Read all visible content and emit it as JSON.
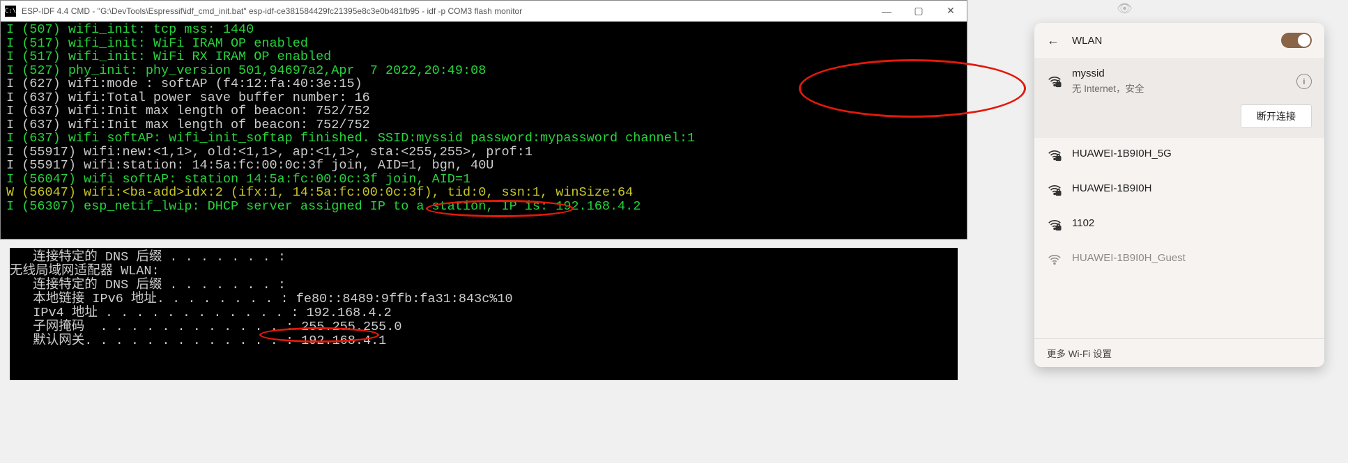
{
  "terminal": {
    "title": "ESP-IDF 4.4 CMD - \"G:\\DevTools\\Espressif\\idf_cmd_init.bat\"  esp-idf-ce381584429fc21395e8c3e0b481fb95 - idf  -p COM3 flash monitor",
    "icon_text": "C:\\",
    "lines": [
      {
        "cls": "green",
        "text": "I (507) wifi_init: tcp mss: 1440"
      },
      {
        "cls": "green",
        "text": "I (517) wifi_init: WiFi IRAM OP enabled"
      },
      {
        "cls": "green",
        "text": "I (517) wifi_init: WiFi RX IRAM OP enabled"
      },
      {
        "cls": "green",
        "text": "I (527) phy_init: phy_version 501,94697a2,Apr  7 2022,20:49:08"
      },
      {
        "cls": "white",
        "text": "I (627) wifi:mode : softAP (f4:12:fa:40:3e:15)"
      },
      {
        "cls": "white",
        "text": "I (637) wifi:Total power save buffer number: 16"
      },
      {
        "cls": "white",
        "text": "I (637) wifi:Init max length of beacon: 752/752"
      },
      {
        "cls": "white",
        "text": "I (637) wifi:Init max length of beacon: 752/752"
      },
      {
        "cls": "green",
        "text": "I (637) wifi softAP: wifi_init_softap finished. SSID:myssid password:mypassword channel:1"
      },
      {
        "cls": "white",
        "text": "I (55917) wifi:new:<1,1>, old:<1,1>, ap:<1,1>, sta:<255,255>, prof:1"
      },
      {
        "cls": "white",
        "text": "I (55917) wifi:station: 14:5a:fc:00:0c:3f join, AID=1, bgn, 40U"
      },
      {
        "cls": "green",
        "text": "I (56047) wifi softAP: station 14:5a:fc:00:0c:3f join, AID=1"
      },
      {
        "cls": "yellow",
        "text": "W (56047) wifi:<ba-add>idx:2 (ifx:1, 14:5a:fc:00:0c:3f), tid:0, ssn:1, winSize:64"
      },
      {
        "cls": "green",
        "text": "I (56307) esp_netif_lwip: DHCP server assigned IP to a station, IP is: 192.168.4.2"
      }
    ]
  },
  "cmd2": {
    "lines": [
      "   连接特定的 DNS 后缀 . . . . . . . :",
      "",
      "无线局域网适配器 WLAN:",
      "",
      "   连接特定的 DNS 后缀 . . . . . . . :",
      "   本地链接 IPv6 地址. . . . . . . . : fe80::8489:9ffb:fa31:843c%10",
      "   IPv4 地址 . . . . . . . . . . . . : 192.168.4.2",
      "   子网掩码  . . . . . . . . . . . . : 255.255.255.0",
      "   默认网关. . . . . . . . . . . . . : 192.168.4.1"
    ]
  },
  "wifi": {
    "title": "WLAN",
    "connected": {
      "name": "myssid",
      "status": "无 Internet，安全",
      "disconnect": "断开连接"
    },
    "networks": [
      {
        "name": "HUAWEI-1B9I0H_5G"
      },
      {
        "name": "HUAWEI-1B9I0H"
      },
      {
        "name": "1102"
      },
      {
        "name": "HUAWEI-1B9I0H_Guest"
      }
    ],
    "footer": "更多 Wi-Fi 设置"
  }
}
